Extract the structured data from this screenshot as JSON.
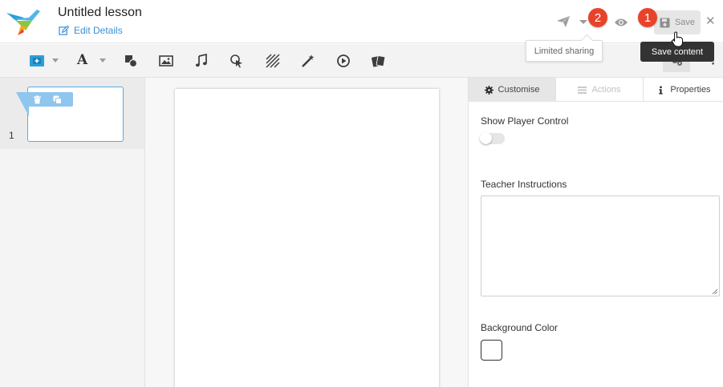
{
  "header": {
    "title": "Untitled lesson",
    "edit_details": "Edit Details",
    "save_label": "Save",
    "badge_one": "1",
    "badge_two": "2",
    "tooltip_share": "Limited sharing",
    "tooltip_save": "Save content"
  },
  "toolbar": {
    "text_tool_glyph": "A",
    "icons": [
      "add-slide-icon",
      "text-icon",
      "shapes-icon",
      "image-icon",
      "audio-icon",
      "hotspot-icon",
      "hatch-icon",
      "magic-wand-icon",
      "video-play-icon",
      "cards-icon",
      "settings-icon"
    ]
  },
  "slides": {
    "items": [
      {
        "number": "1"
      }
    ]
  },
  "panel": {
    "tabs": {
      "customise": "Customise",
      "actions": "Actions",
      "properties": "Properties"
    },
    "show_player_control": "Show Player Control",
    "teacher_instructions": "Teacher Instructions",
    "teacher_instructions_value": "",
    "background_color": "Background Color",
    "background_color_value": "#ffffff",
    "show_player_control_on": false
  },
  "colors": {
    "accent_blue": "#3a8fd6",
    "badge_red": "#e8432a",
    "slide_tools_blue": "#8ec6ee"
  }
}
